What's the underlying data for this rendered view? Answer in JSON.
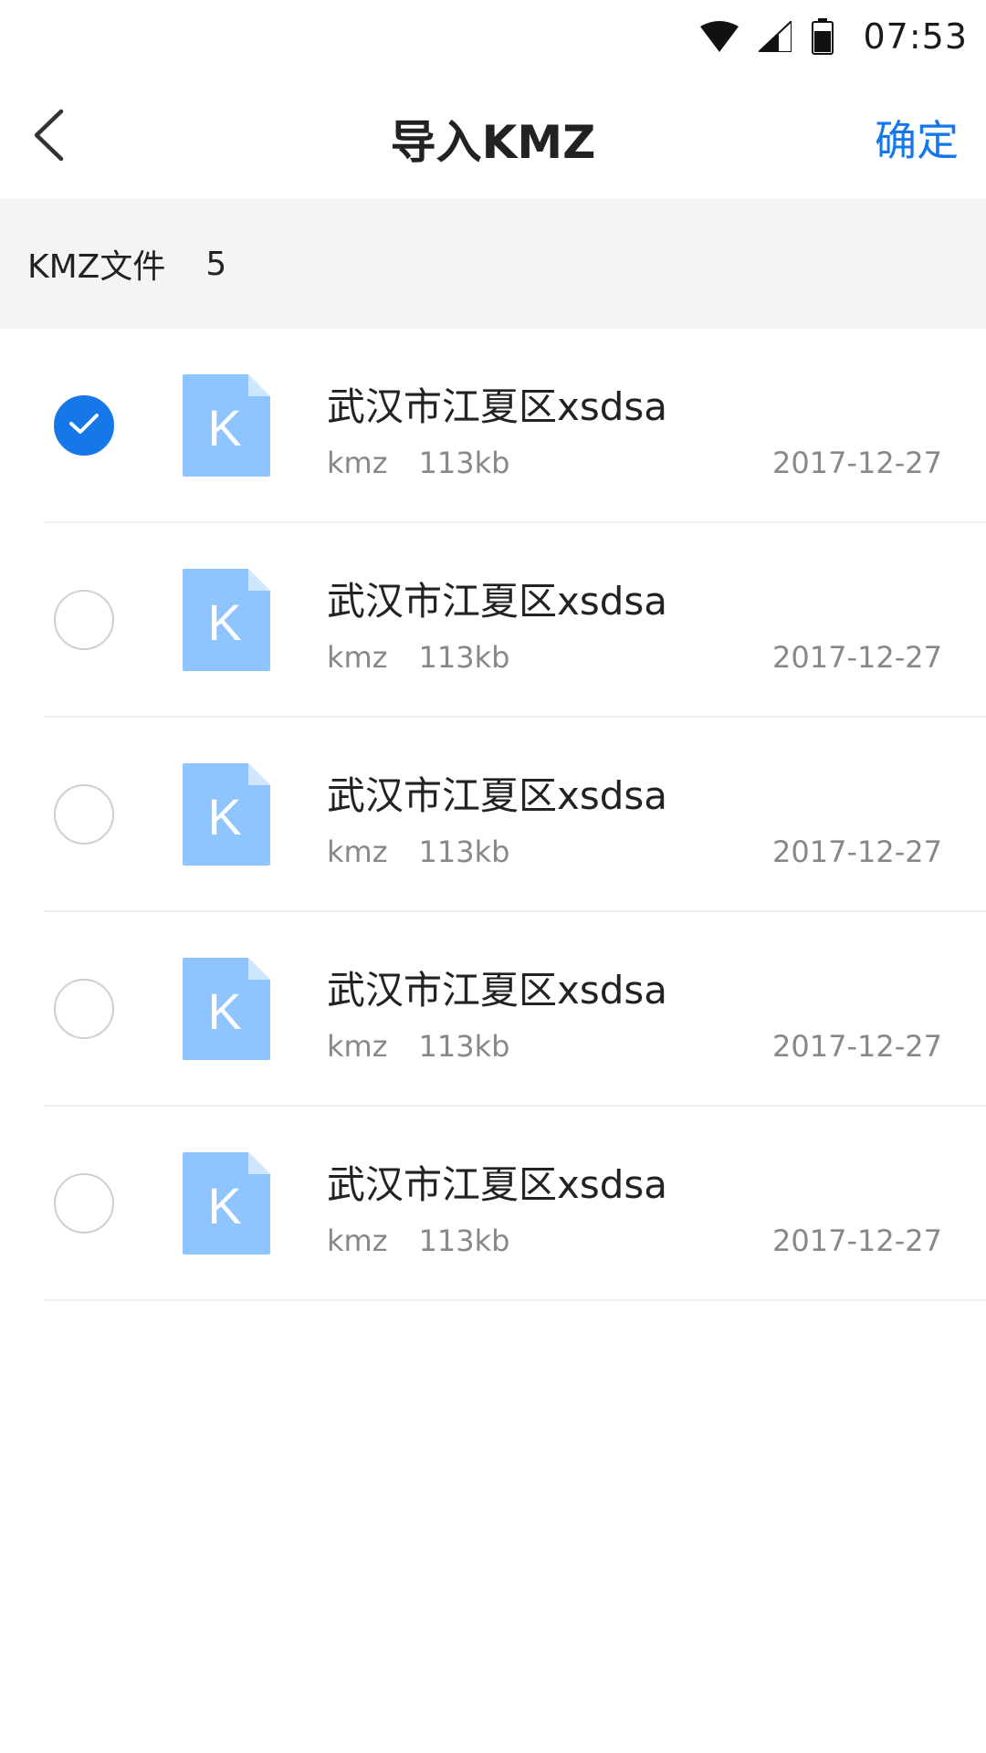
{
  "status_bar": {
    "time": "07:53",
    "icons": [
      "wifi-icon",
      "signal-icon",
      "battery-icon"
    ]
  },
  "header": {
    "title": "导入KMZ",
    "confirm_label": "确定",
    "back_icon": "chevron-left-icon"
  },
  "section": {
    "label": "KMZ文件",
    "count": "5"
  },
  "colors": {
    "accent": "#1677e8",
    "file_icon": "#8ec5ff",
    "section_bg": "#f3f4f6"
  },
  "files": [
    {
      "icon_letter": "K",
      "name": "武汉市江夏区xsdsa",
      "type": "kmz",
      "size": "113kb",
      "date": "2017-12-27",
      "selected": true
    },
    {
      "icon_letter": "K",
      "name": "武汉市江夏区xsdsa",
      "type": "kmz",
      "size": "113kb",
      "date": "2017-12-27",
      "selected": false
    },
    {
      "icon_letter": "K",
      "name": "武汉市江夏区xsdsa",
      "type": "kmz",
      "size": "113kb",
      "date": "2017-12-27",
      "selected": false
    },
    {
      "icon_letter": "K",
      "name": "武汉市江夏区xsdsa",
      "type": "kmz",
      "size": "113kb",
      "date": "2017-12-27",
      "selected": false
    },
    {
      "icon_letter": "K",
      "name": "武汉市江夏区xsdsa",
      "type": "kmz",
      "size": "113kb",
      "date": "2017-12-27",
      "selected": false
    }
  ]
}
